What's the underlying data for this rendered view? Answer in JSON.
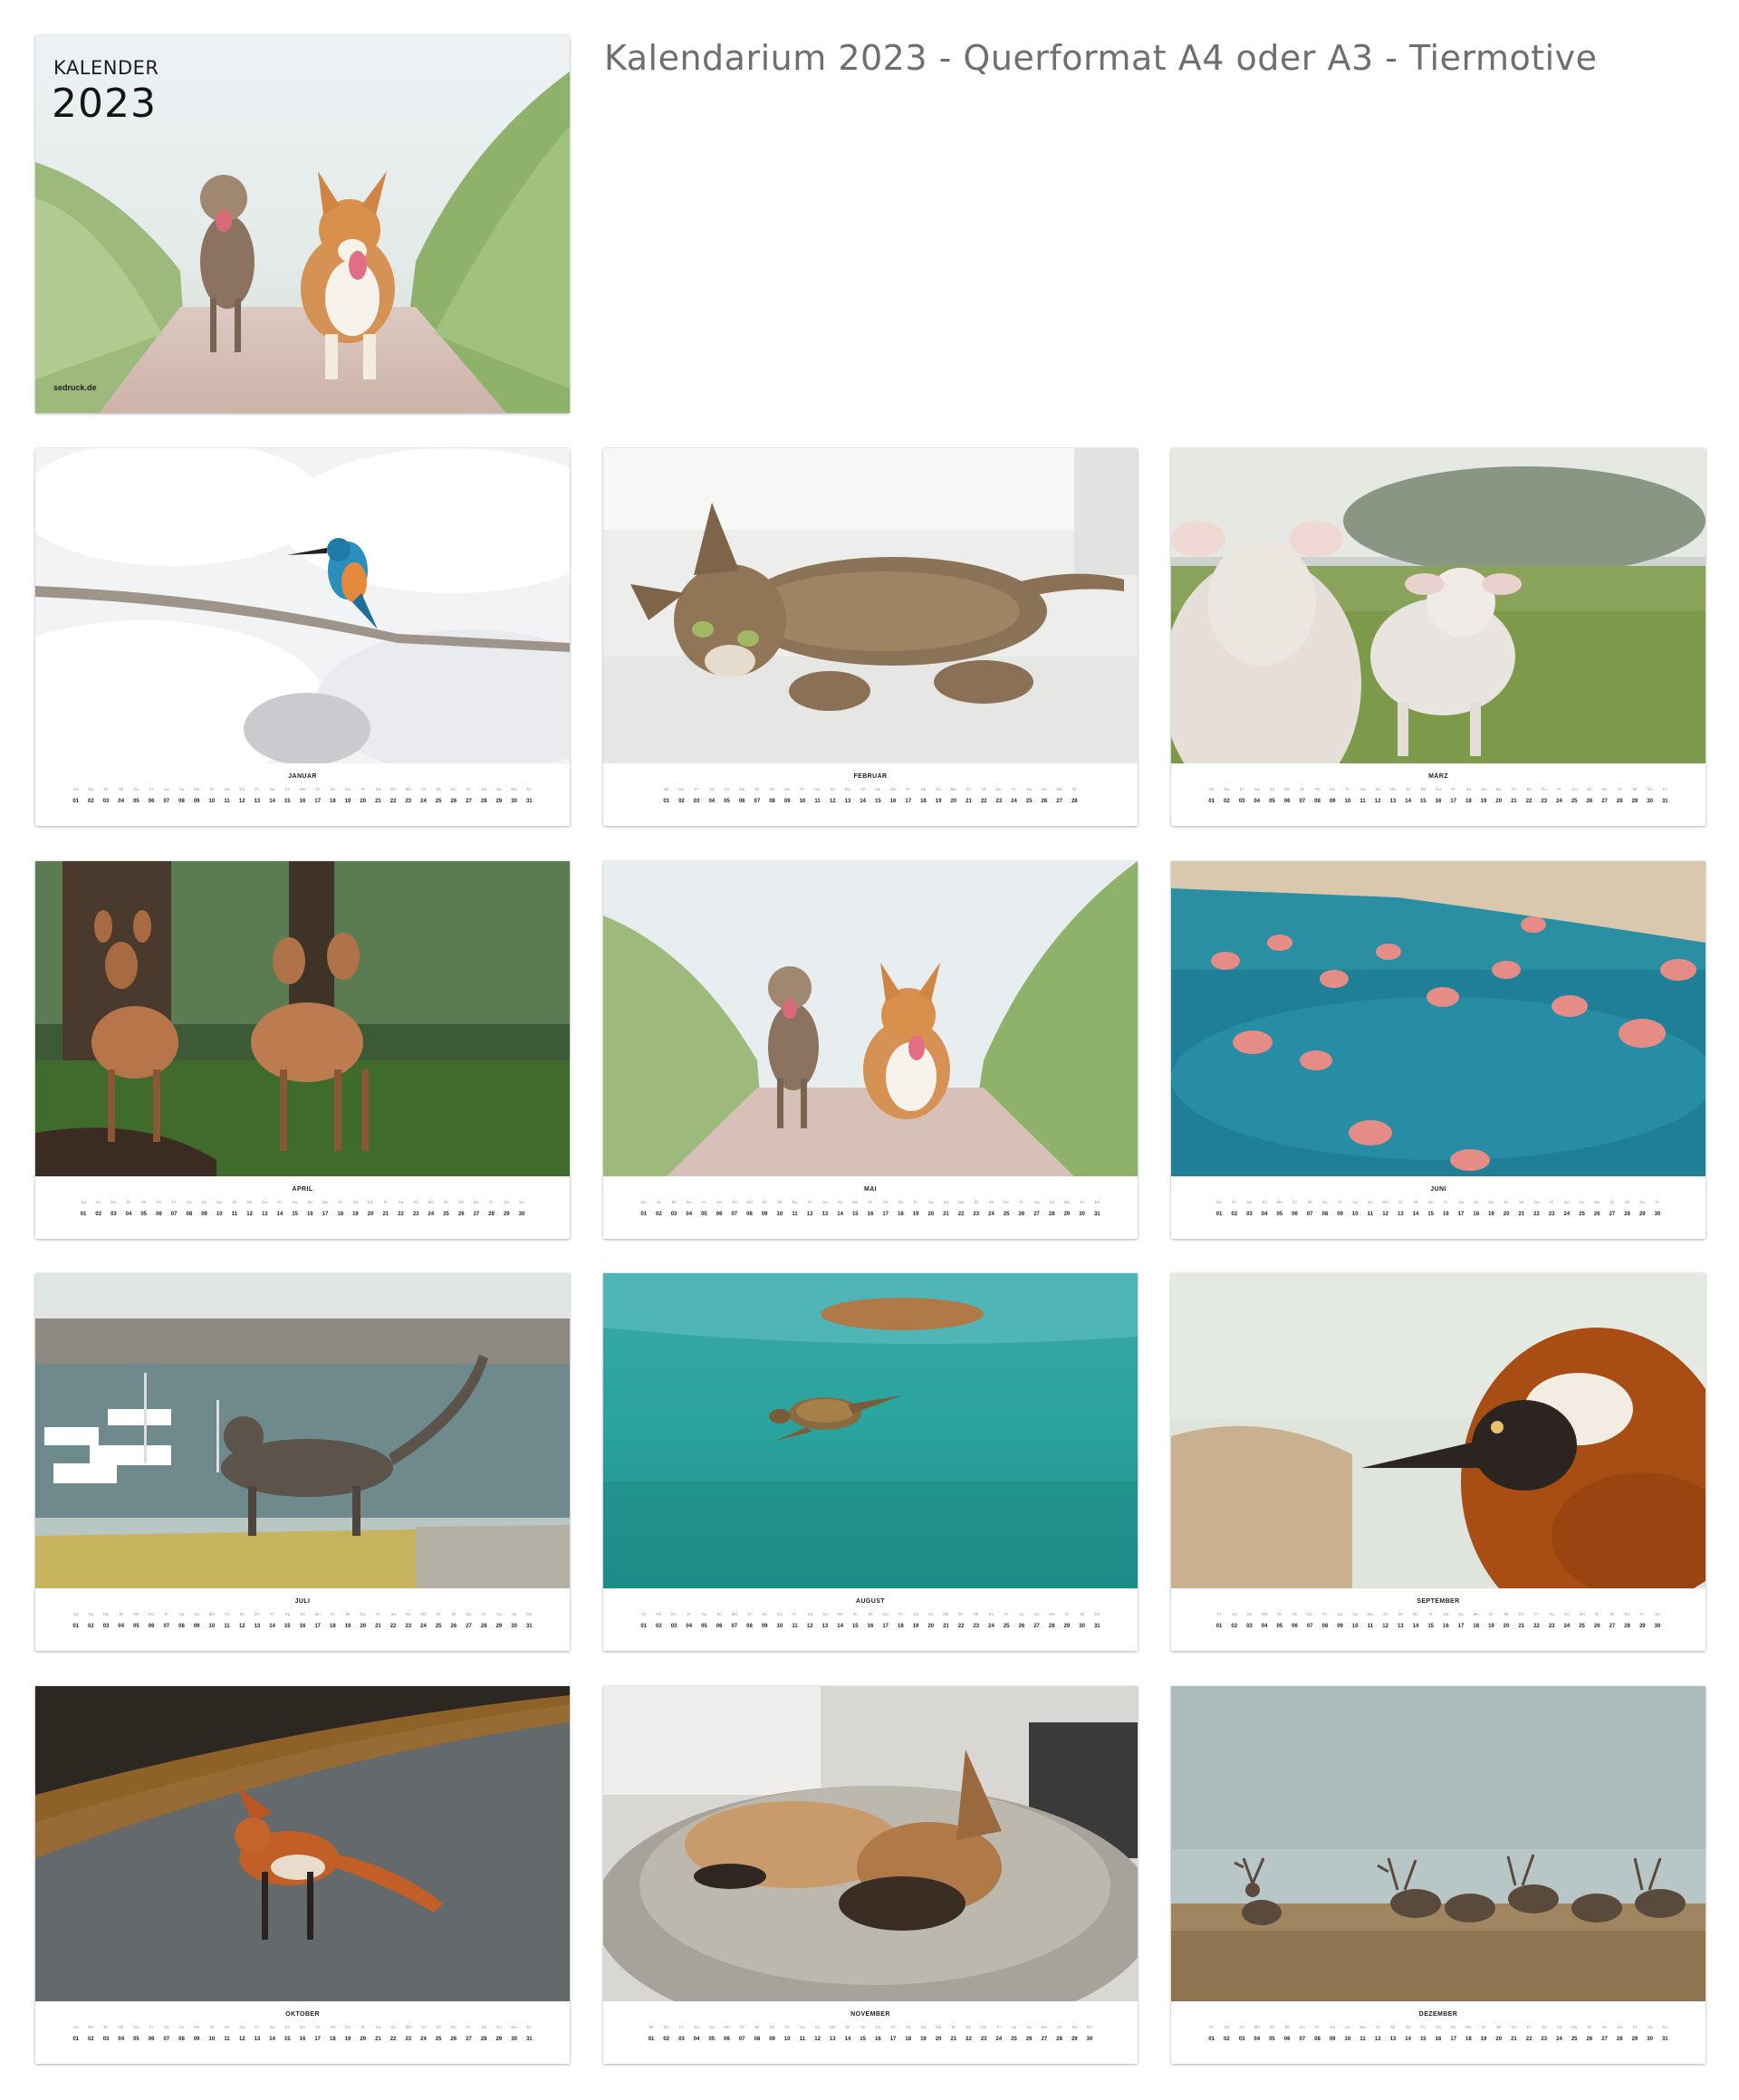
{
  "page": {
    "title": "Kalendarium 2023 - Querformat A4 oder A3 - Tiermotive"
  },
  "cover": {
    "label": "KALENDER",
    "year": "2023",
    "brand": "sedruck.de"
  },
  "months": [
    {
      "name": "JANUAR",
      "days": 31,
      "first_weekday": 6
    },
    {
      "name": "FEBRUAR",
      "days": 28,
      "first_weekday": 2
    },
    {
      "name": "MÄRZ",
      "days": 31,
      "first_weekday": 2
    },
    {
      "name": "APRIL",
      "days": 30,
      "first_weekday": 5
    },
    {
      "name": "MAI",
      "days": 31,
      "first_weekday": 0
    },
    {
      "name": "JUNI",
      "days": 30,
      "first_weekday": 3
    },
    {
      "name": "JULI",
      "days": 31,
      "first_weekday": 5
    },
    {
      "name": "AUGUST",
      "days": 31,
      "first_weekday": 1
    },
    {
      "name": "SEPTEMBER",
      "days": 30,
      "first_weekday": 4
    },
    {
      "name": "OKTOBER",
      "days": 31,
      "first_weekday": 6
    },
    {
      "name": "NOVEMBER",
      "days": 30,
      "first_weekday": 2
    },
    {
      "name": "DEZEMBER",
      "days": 31,
      "first_weekday": 4
    }
  ],
  "weekday_abbr": [
    "Mo",
    "Di",
    "Mi",
    "Do",
    "Fr",
    "Sa",
    "So"
  ]
}
